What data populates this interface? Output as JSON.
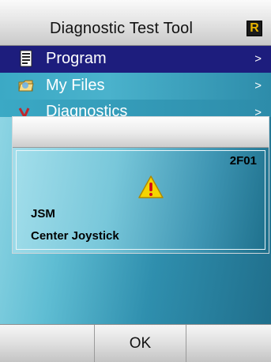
{
  "header": {
    "title": "Diagnostic Test Tool",
    "logo_letter": "R"
  },
  "menu": {
    "items": [
      {
        "label": "Program",
        "chevron": ">",
        "icon": "document-icon",
        "selected": true
      },
      {
        "label": "My Files",
        "chevron": ">",
        "icon": "folder-icon",
        "selected": false
      },
      {
        "label": "Diagnostics",
        "chevron": ">",
        "icon": "diagnostics-icon",
        "selected": false
      }
    ]
  },
  "dialog": {
    "code": "2F01",
    "icon": "warning-icon",
    "line1": "JSM",
    "line2": "Center Joystick"
  },
  "softkeys": {
    "left": "",
    "center": "OK",
    "right": ""
  },
  "colors": {
    "selected_row": "#1d1d7d",
    "logo_bg": "#1a1a1a",
    "logo_fg": "#e8b400",
    "warning": "#f5d400"
  }
}
